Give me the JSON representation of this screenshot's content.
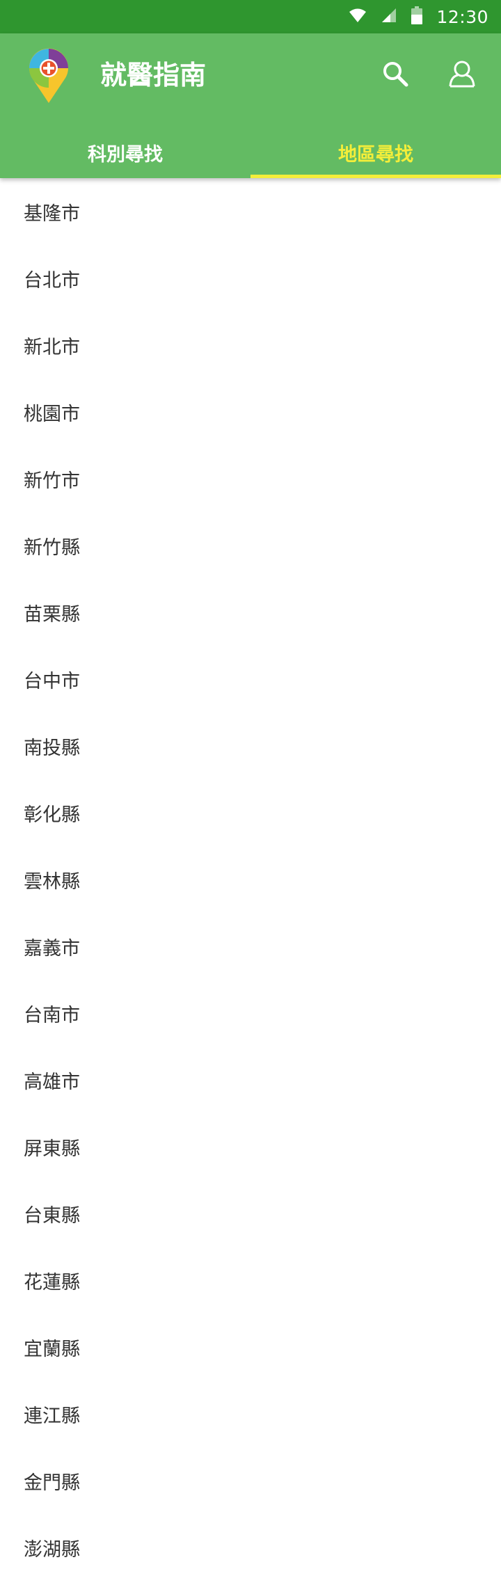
{
  "status_bar": {
    "time": "12:30",
    "icons": [
      "wifi-icon",
      "cellular-signal-icon",
      "battery-icon"
    ]
  },
  "app_bar": {
    "title": "就醫指南",
    "logo": "map-pin-medical-logo",
    "actions": [
      {
        "name": "search",
        "icon": "search-icon"
      },
      {
        "name": "account",
        "icon": "account-icon"
      }
    ]
  },
  "tabs": [
    {
      "label": "科別尋找",
      "selected": false
    },
    {
      "label": "地區尋找",
      "selected": true
    }
  ],
  "colors": {
    "status_bar": "#2f962f",
    "app_bar": "#63bb63",
    "active_tab": "#f4ee3a",
    "list_text": "#333333"
  },
  "regions": [
    "基隆市",
    "台北市",
    "新北市",
    "桃園市",
    "新竹市",
    "新竹縣",
    "苗栗縣",
    "台中市",
    "南投縣",
    "彰化縣",
    "雲林縣",
    "嘉義市",
    "台南市",
    "高雄市",
    "屏東縣",
    "台東縣",
    "花蓮縣",
    "宜蘭縣",
    "連江縣",
    "金門縣",
    "澎湖縣"
  ]
}
